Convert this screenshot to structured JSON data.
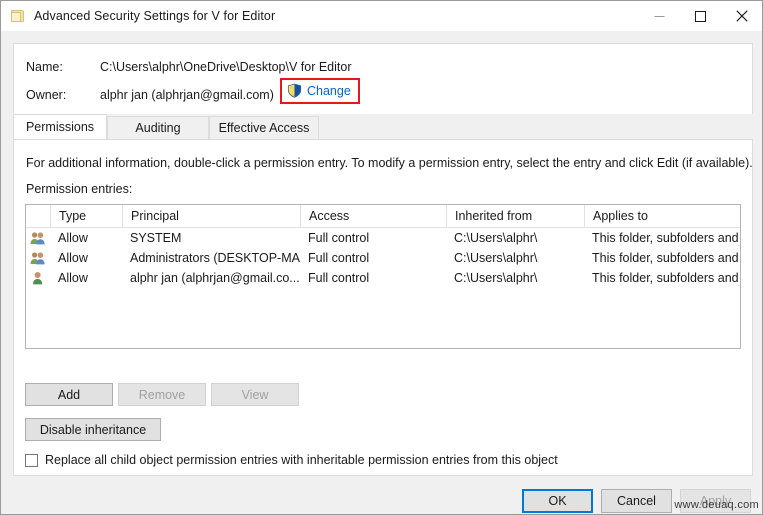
{
  "window": {
    "title": "Advanced Security Settings for V for Editor",
    "icon": "folder-icon",
    "minimize_label": "—",
    "maximize_label": "□",
    "close_label": "✕"
  },
  "header": {
    "name_label": "Name:",
    "name_value": "C:\\Users\\alphr\\OneDrive\\Desktop\\V for Editor",
    "owner_label": "Owner:",
    "owner_value": "alphr jan (alphrjan@gmail.com)",
    "change_link": "Change",
    "change_icon": "uac-shield-icon",
    "annotation_color": "#e01b1b"
  },
  "tabs": [
    {
      "label": "Permissions",
      "selected": true
    },
    {
      "label": "Auditing",
      "selected": false
    },
    {
      "label": "Effective Access",
      "selected": false
    }
  ],
  "main": {
    "info_text": "For additional information, double-click a permission entry. To modify a permission entry, select the entry and click Edit (if available).",
    "entries_label": "Permission entries:",
    "columns": [
      "",
      "Type",
      "Principal",
      "Access",
      "Inherited from",
      "Applies to"
    ],
    "rows": [
      {
        "icon": "group-icon",
        "type": "Allow",
        "principal": "SYSTEM",
        "access": "Full control",
        "inherited_from": "C:\\Users\\alphr\\",
        "applies_to": "This folder, subfolders and files"
      },
      {
        "icon": "group-icon",
        "type": "Allow",
        "principal": "Administrators (DESKTOP-MA...",
        "access": "Full control",
        "inherited_from": "C:\\Users\\alphr\\",
        "applies_to": "This folder, subfolders and files"
      },
      {
        "icon": "user-icon",
        "type": "Allow",
        "principal": "alphr jan (alphrjan@gmail.co...",
        "access": "Full control",
        "inherited_from": "C:\\Users\\alphr\\",
        "applies_to": "This folder, subfolders and files"
      }
    ],
    "buttons": {
      "add": "Add",
      "remove": "Remove",
      "view": "View",
      "disable_inheritance": "Disable inheritance"
    },
    "replace_checkbox": {
      "label": "Replace all child object permission entries with inheritable permission entries from this object",
      "checked": false
    }
  },
  "footer": {
    "ok": "OK",
    "cancel": "Cancel",
    "apply": "Apply"
  },
  "watermark": "www.deuaq.com"
}
